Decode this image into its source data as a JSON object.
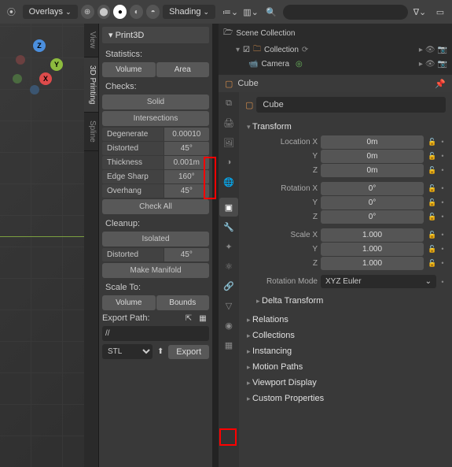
{
  "header_left": {
    "overlays_label": "Overlays",
    "shading_label": "Shading"
  },
  "axes": {
    "x": "X",
    "y": "Y",
    "z": "Z"
  },
  "n_panel": {
    "title": "Print3D",
    "stats_label": "Statistics:",
    "volume_btn": "Volume",
    "area_btn": "Area",
    "checks_label": "Checks:",
    "solid_btn": "Solid",
    "intersections_btn": "Intersections",
    "checks": [
      {
        "label": "Degenerate",
        "val": "0.00010"
      },
      {
        "label": "Distorted",
        "val": "45°"
      },
      {
        "label": "Thickness",
        "val": "0.001m"
      },
      {
        "label": "Edge Sharp",
        "val": "160°"
      },
      {
        "label": "Overhang",
        "val": "45°"
      }
    ],
    "check_all_btn": "Check All",
    "cleanup_label": "Cleanup:",
    "isolated_btn": "Isolated",
    "cleanup_distorted_label": "Distorted",
    "cleanup_distorted_val": "45°",
    "make_manifold_btn": "Make Manifold",
    "scale_to_label": "Scale To:",
    "scale_volume_btn": "Volume",
    "scale_bounds_btn": "Bounds",
    "export_path_label": "Export Path:",
    "path_value": "//",
    "format": "STL",
    "export_btn": "Export"
  },
  "vert_tabs": {
    "view": "View",
    "printing": "3D Printing",
    "spline": "Spline"
  },
  "outliner": {
    "scene": "Scene Collection",
    "collection": "Collection",
    "camera": "Camera"
  },
  "props": {
    "breadcrumb_obj": "Cube",
    "obj_name": "Cube",
    "transform_title": "Transform",
    "location": [
      {
        "label": "Location X",
        "val": "0m"
      },
      {
        "label": "Y",
        "val": "0m"
      },
      {
        "label": "Z",
        "val": "0m"
      }
    ],
    "rotation": [
      {
        "label": "Rotation X",
        "val": "0°"
      },
      {
        "label": "Y",
        "val": "0°"
      },
      {
        "label": "Z",
        "val": "0°"
      }
    ],
    "scale": [
      {
        "label": "Scale X",
        "val": "1.000"
      },
      {
        "label": "Y",
        "val": "1.000"
      },
      {
        "label": "Z",
        "val": "1.000"
      }
    ],
    "rotation_mode_label": "Rotation Mode",
    "rotation_mode_val": "XYZ Euler",
    "delta_title": "Delta Transform",
    "sections": [
      "Relations",
      "Collections",
      "Instancing",
      "Motion Paths",
      "Viewport Display",
      "Custom Properties"
    ]
  },
  "search_placeholder": ""
}
